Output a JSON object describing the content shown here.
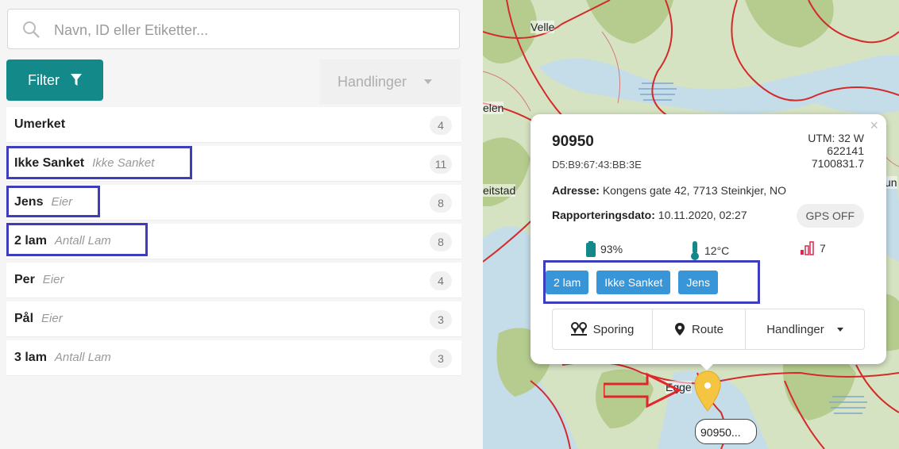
{
  "search": {
    "placeholder": "Navn, ID eller Etiketter..."
  },
  "toolbar": {
    "filter_label": "Filter",
    "actions_label": "Handlinger"
  },
  "list": [
    {
      "name": "Umerket",
      "sub": "",
      "count": "4"
    },
    {
      "name": "Ikke Sanket",
      "sub": "Ikke Sanket",
      "count": "11"
    },
    {
      "name": "Jens",
      "sub": "Eier",
      "count": "8"
    },
    {
      "name": "2 lam",
      "sub": "Antall Lam",
      "count": "8"
    },
    {
      "name": "Per",
      "sub": "Eier",
      "count": "4"
    },
    {
      "name": "Pål",
      "sub": "Eier",
      "count": "3"
    },
    {
      "name": "3 lam",
      "sub": "Antall Lam",
      "count": "3"
    }
  ],
  "map": {
    "labels": {
      "velle": "Velle",
      "helen": "elen",
      "steinstad": "eitstad",
      "egge": "Egge",
      "right": "un"
    },
    "marker_label": "90950..."
  },
  "popup": {
    "close": "×",
    "id": "90950",
    "mac": "D5:B9:67:43:BB:3E",
    "utm": {
      "zone": "UTM: 32 W",
      "easting": "622141",
      "northing": "7100831.7"
    },
    "address_label": "Adresse:",
    "address": "Kongens gate 42, 7713 Steinkjer, NO",
    "date_label": "Rapporteringsdato:",
    "date": "10.11.2020, 02:27",
    "gps": "GPS OFF",
    "battery": "93%",
    "temperature": "12°C",
    "signal": "7",
    "tags": [
      "2 lam",
      "Ikke Sanket",
      "Jens"
    ],
    "buttons": {
      "tracking": "Sporing",
      "route": "Route",
      "actions": "Handlinger"
    }
  },
  "colors": {
    "primary": "#13898a",
    "tag": "#3896d8",
    "highlight": "#3e3ebd",
    "arrow": "#e0262a",
    "marker": "#f5c542"
  }
}
